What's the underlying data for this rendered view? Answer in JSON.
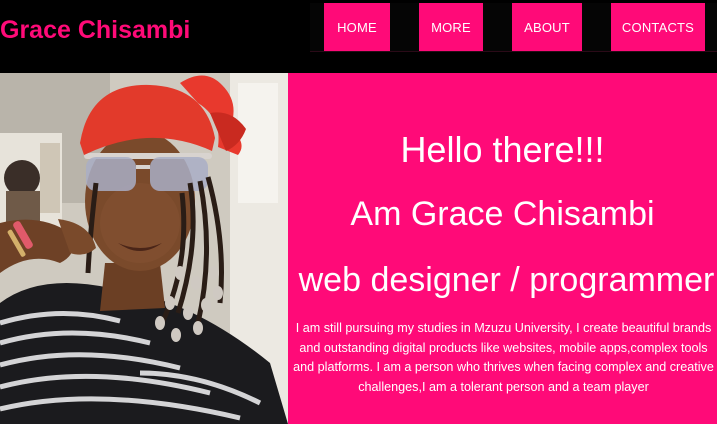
{
  "brand": {
    "name": "Grace Chisambi"
  },
  "nav": {
    "items": [
      {
        "label": "HOME"
      },
      {
        "label": "MORE"
      },
      {
        "label": "ABOUT"
      },
      {
        "label": "CONTACTS"
      }
    ]
  },
  "hero": {
    "greeting": "Hello there!!!",
    "name_line": "Am Grace Chisambi",
    "role": "web designer / programmer",
    "bio": "I am still pursuing my studies in Mzuzu University, I create beautiful brands and outstanding digital products like websites, mobile apps,complex tools and platforms. I am a person who thrives when facing complex and creative challenges,I am a tolerant person and a team player"
  },
  "colors": {
    "accent": "#ff0a78",
    "background": "#000000",
    "text_on_accent": "#ffffff"
  },
  "photo": {
    "subject": "portrait of woman with red headscarf, sunglasses and beaded braids"
  }
}
